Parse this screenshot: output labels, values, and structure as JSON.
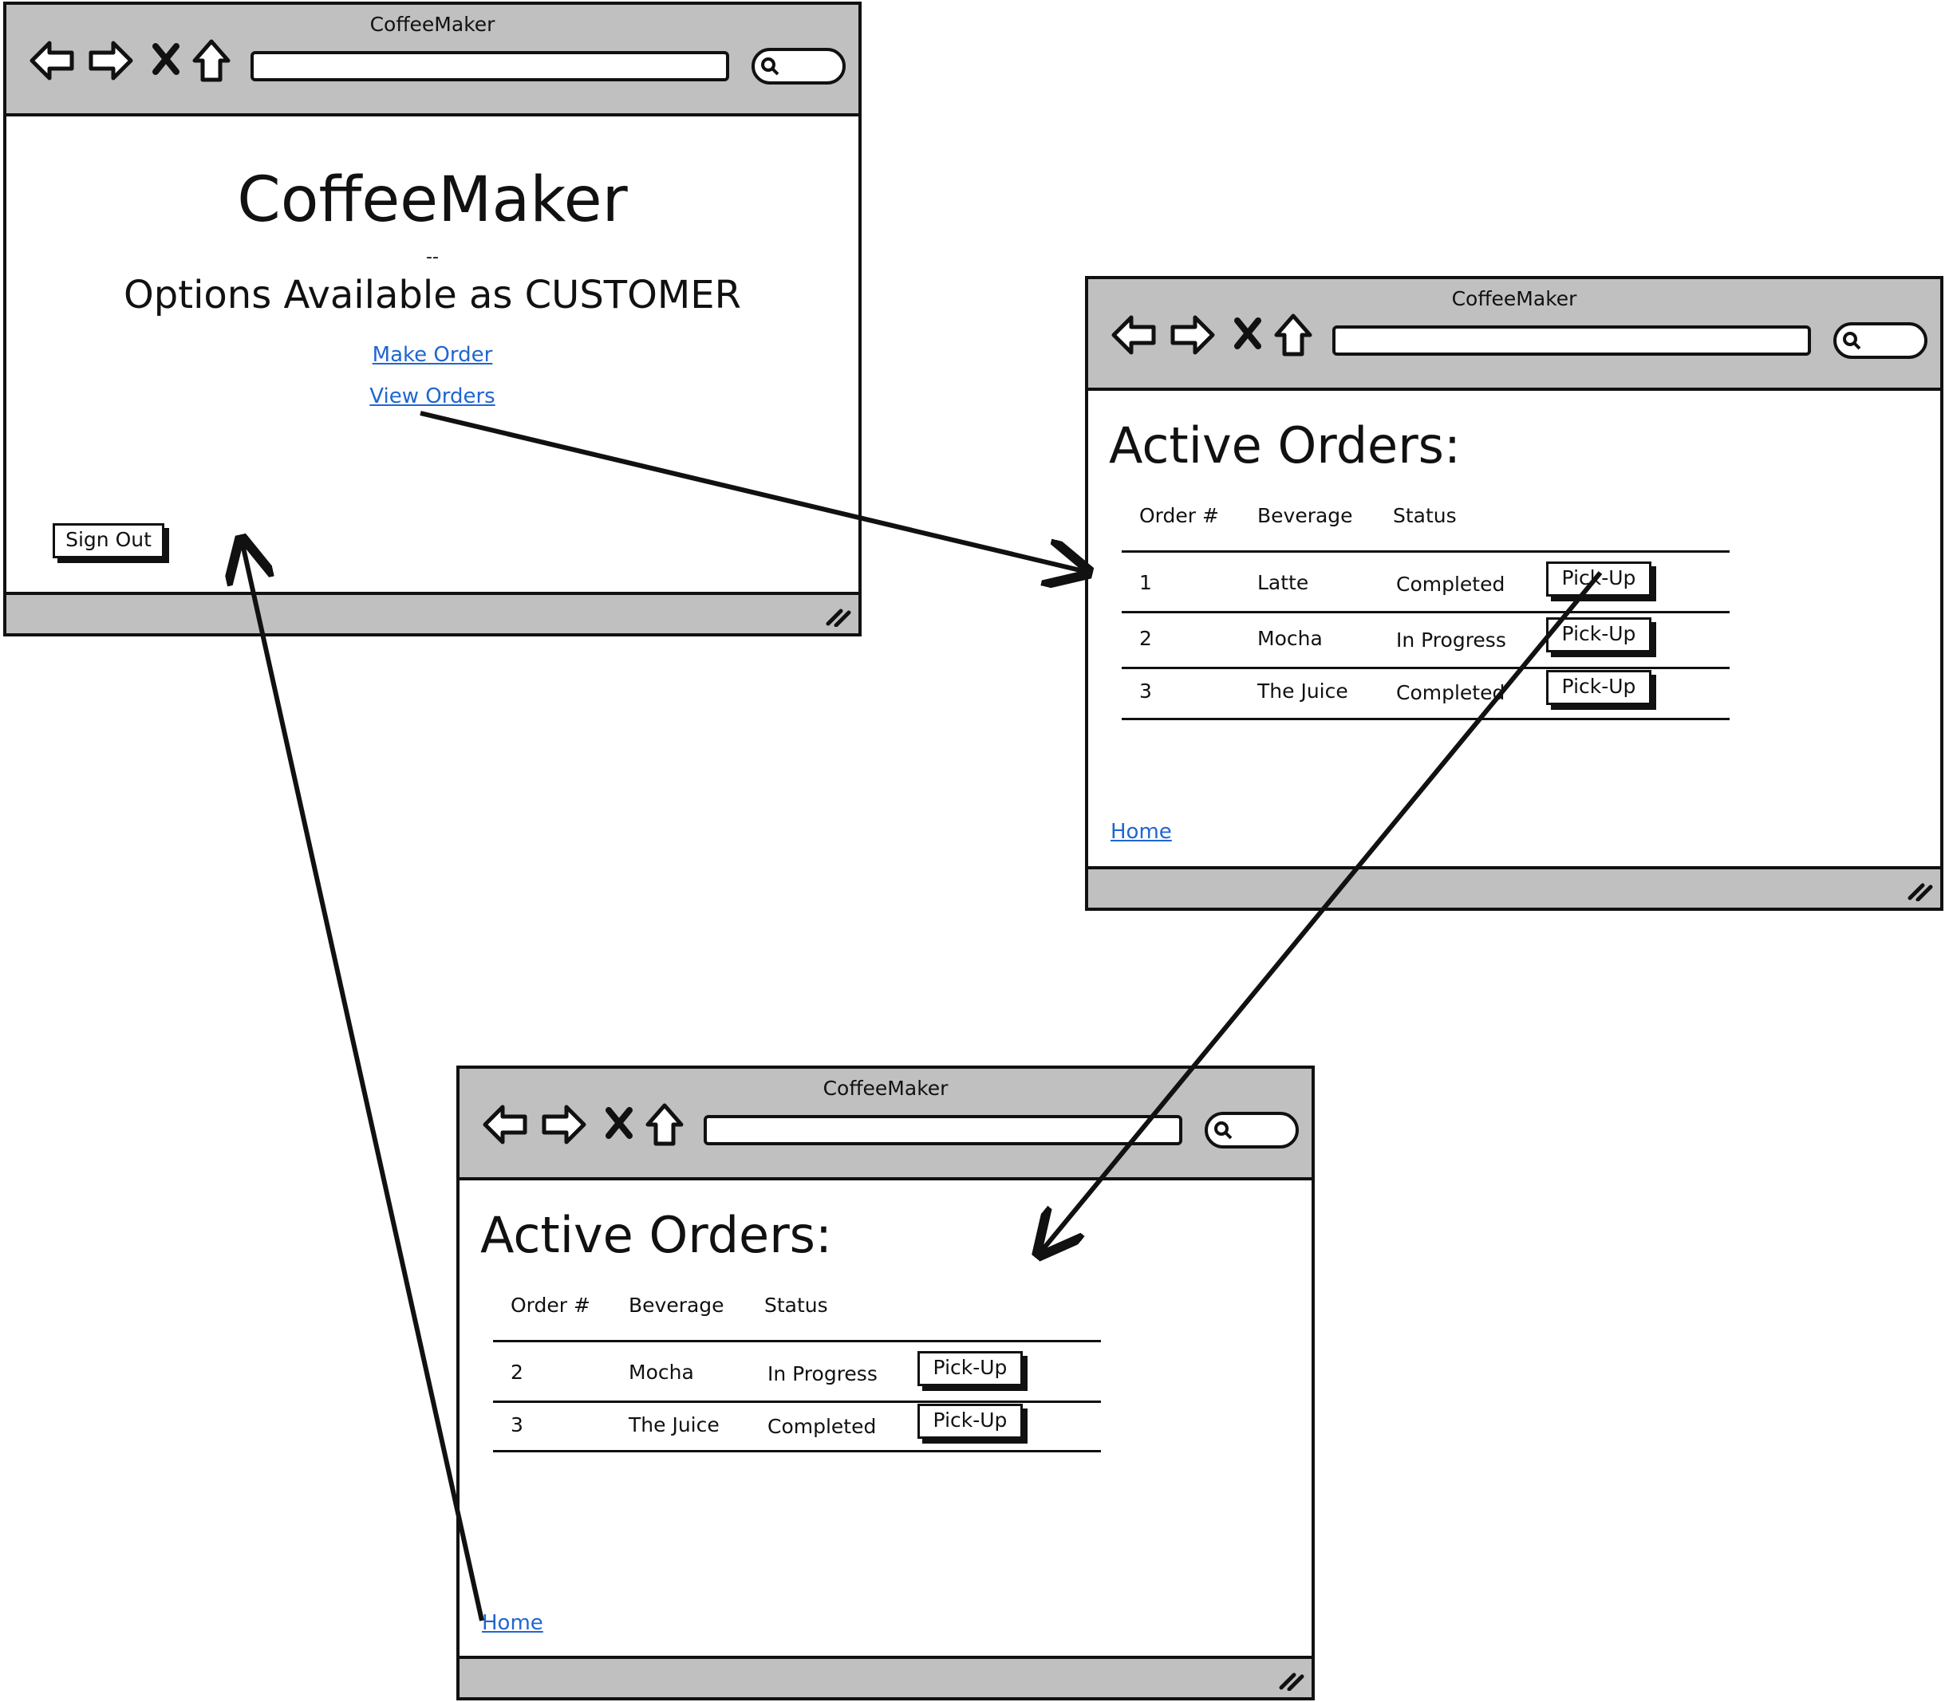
{
  "window_title": "CoffeeMaker",
  "home_screen": {
    "title": "CoffeeMaker",
    "separator": "--",
    "subtitle": "Options Available as CUSTOMER",
    "links": [
      "Make Order",
      "View Orders"
    ],
    "sign_out": "Sign Out"
  },
  "orders_screen_1": {
    "heading": "Active Orders:",
    "columns": [
      "Order #",
      "Beverage",
      "Status"
    ],
    "rows": [
      {
        "order": "1",
        "beverage": "Latte",
        "status": "Completed",
        "action": "Pick-Up"
      },
      {
        "order": "2",
        "beverage": "Mocha",
        "status": "In Progress",
        "action": "Pick-Up"
      },
      {
        "order": "3",
        "beverage": "The Juice",
        "status": "Completed",
        "action": "Pick-Up"
      }
    ],
    "home_link": "Home"
  },
  "orders_screen_2": {
    "heading": "Active Orders:",
    "columns": [
      "Order #",
      "Beverage",
      "Status"
    ],
    "rows": [
      {
        "order": "2",
        "beverage": "Mocha",
        "status": "In Progress",
        "action": "Pick-Up"
      },
      {
        "order": "3",
        "beverage": "The Juice",
        "status": "Completed",
        "action": "Pick-Up"
      }
    ],
    "home_link": "Home"
  },
  "colors": {
    "chrome": "#c0c0c0",
    "link": "#1f66d1",
    "stroke": "#111111"
  },
  "icons": [
    "back-arrow-icon",
    "forward-arrow-icon",
    "close-x-icon",
    "home-icon",
    "search-icon",
    "resize-grip-icon"
  ]
}
